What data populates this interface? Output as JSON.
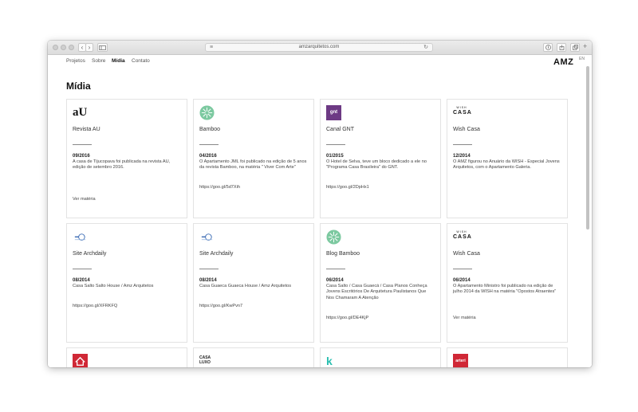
{
  "browser": {
    "url": "amzarquitetos.com",
    "back_icon": "chevron-left-icon",
    "forward_icon": "chevron-right-icon"
  },
  "nav": {
    "items": [
      {
        "label": "Projetos"
      },
      {
        "label": "Sobre"
      },
      {
        "label": "Mídia"
      },
      {
        "label": "Contato"
      }
    ],
    "logo": "AMZ",
    "lang": "EN"
  },
  "page": {
    "title": "Mídia"
  },
  "cards": [
    {
      "icon_text": "aU",
      "name": "Revista AU",
      "date": "09/2016",
      "desc": "A casa de Tijucopava foi publicada na revista AU, edição de setembro 2016.",
      "link": "Ver matéria"
    },
    {
      "icon_text": "",
      "name": "Bamboo",
      "date": "04/2016",
      "desc": "O Apartamento JML foi publicado na edição de 5 anos da revista Bamboo, na matéria \" Viver Com Arte\"",
      "link": "https://goo.gl/5d7Xih"
    },
    {
      "icon_text": "gnt",
      "name": "Canal GNT",
      "date": "01/2015",
      "desc": "O Hotel de Selva, teve um bloco dedicado a ele no \"Programa Casa Brasileira\" do GNT.",
      "link": "https://goo.gl/2DpHx1"
    },
    {
      "icon_text": "WISH CASA",
      "name": "Wish Casa",
      "date": "12/2014",
      "desc": "O AMZ figurou no Anuário da WISH - Especial Jovens Arquitetos, com o Apartamento Galeria.",
      "link": ""
    },
    {
      "icon_text": "",
      "name": "Site Archdaily",
      "date": "08/2014",
      "desc": "Casa Salto Salto House / Amz Arquitetos",
      "link": "https://goo.gl/XFRKFQ"
    },
    {
      "icon_text": "",
      "name": "Site Archdaily",
      "date": "08/2014",
      "desc": "Casa Guaeca Guaeca House / Amz Arquitetos",
      "link": "https://goo.gl/KwPvn7"
    },
    {
      "icon_text": "",
      "name": "Blog Bamboo",
      "date": "06/2014",
      "desc": "Casa Salto / Casa Guaecá / Casa Planos Conheça Jovens Escritórios De Arquitetura Paulistanos Que Nos Chamaram A Atenção",
      "link": "https://goo.gl/DE4KjP"
    },
    {
      "icon_text": "WISH CASA",
      "name": "Wish Casa",
      "date": "06/2014",
      "desc": "O Apartamento Ministro foi publicado na edição de julho 2014 da WISH na matéria \"Opostos Atraentes\"",
      "link": "Ver matéria"
    },
    {
      "icon_text": "",
      "name": "",
      "date": "",
      "desc": "",
      "link": ""
    },
    {
      "icon_text": "CASA LUXO",
      "name": "",
      "date": "",
      "desc": "",
      "link": ""
    },
    {
      "icon_text": "k",
      "name": "",
      "date": "",
      "desc": "",
      "link": ""
    },
    {
      "icon_text": "arteri",
      "name": "",
      "date": "",
      "desc": "",
      "link": ""
    }
  ],
  "colors": {
    "gnt": "#6d3a84",
    "bamboo": "#7cc9a0",
    "red": "#d02836",
    "teal": "#2bbfb0",
    "archdaily": "#3d6db5"
  }
}
